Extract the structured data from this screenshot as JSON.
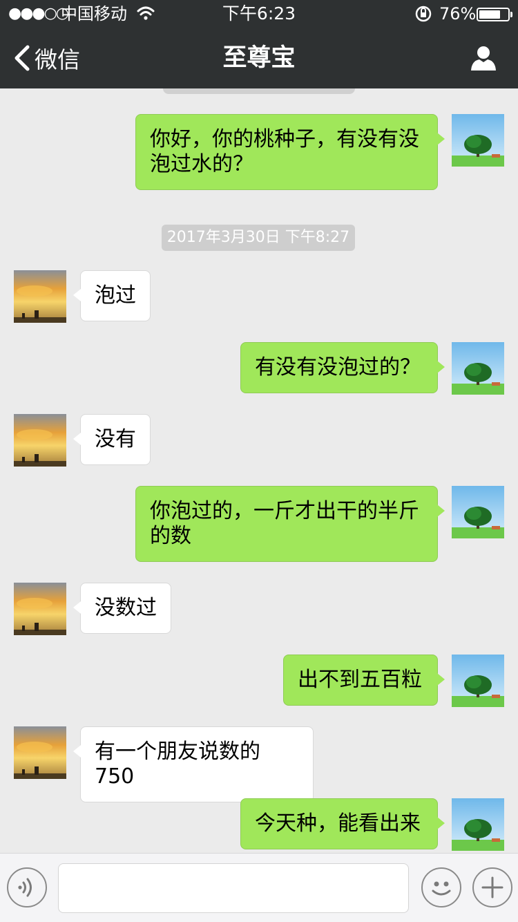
{
  "status_bar": {
    "signal": "●●●○○",
    "carrier": "中国移动",
    "time": "下午6:23",
    "battery_percent": "76%",
    "battery_level": 0.76
  },
  "nav": {
    "back_label": "微信",
    "title": "至尊宝"
  },
  "messages": [
    {
      "type": "outgoing",
      "text": "你好，你的桃种子，有没有没泡过水的？"
    },
    {
      "type": "timestamp",
      "text": "2017年3月30日 下午8:27"
    },
    {
      "type": "incoming",
      "text": "泡过"
    },
    {
      "type": "outgoing",
      "text": "有没有没泡过的？"
    },
    {
      "type": "incoming",
      "text": "没有"
    },
    {
      "type": "outgoing",
      "text": "你泡过的，一斤才出干的半斤的数"
    },
    {
      "type": "incoming",
      "text": "没数过"
    },
    {
      "type": "outgoing",
      "text": "出不到五百粒"
    },
    {
      "type": "incoming",
      "text": "有一个朋友说数的750"
    },
    {
      "type": "outgoing",
      "text": "今天种，能看出来"
    }
  ],
  "icons": {
    "wifi": "wifi-icon",
    "lock": "rotation-lock-icon",
    "back": "chevron-left-icon",
    "profile": "person-icon",
    "voice": "voice-icon",
    "emoji": "smiley-icon",
    "plus": "plus-icon"
  },
  "colors": {
    "header_bg": "#2e3132",
    "chat_bg": "#ebebeb",
    "outgoing_bubble": "#a0e75a",
    "incoming_bubble": "#ffffff"
  }
}
